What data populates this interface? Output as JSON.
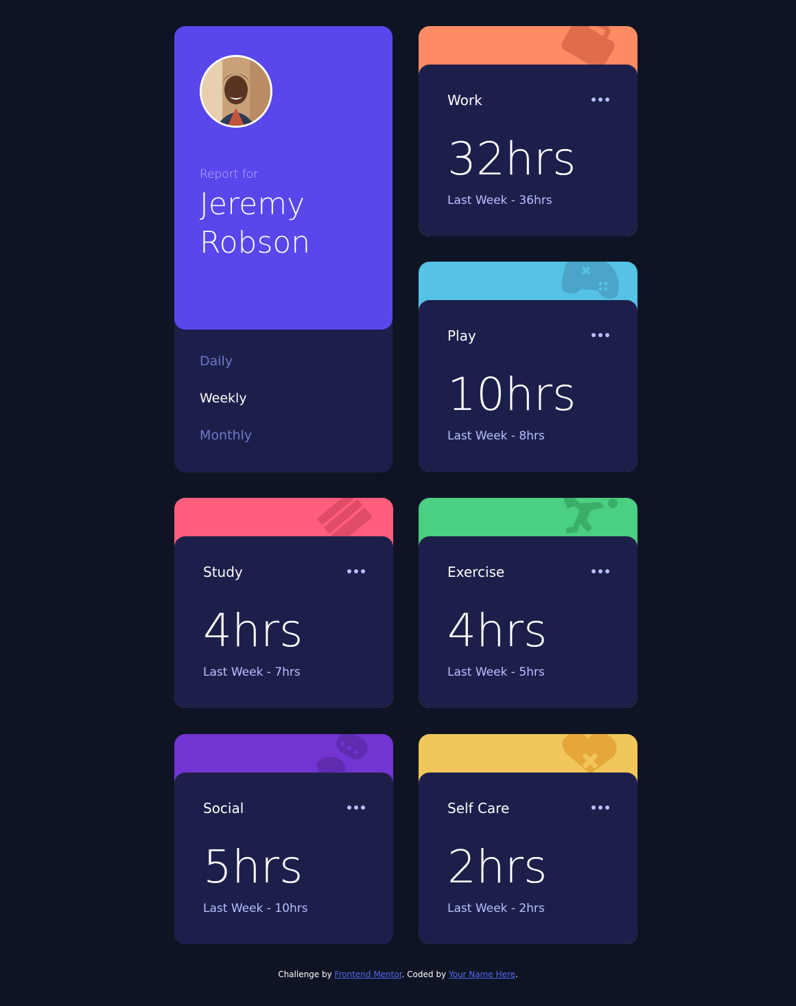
{
  "profile": {
    "report_for": "Report for",
    "first_name": "Jeremy",
    "last_name": "Robson",
    "avatar_icon": "avatar-photo"
  },
  "periods": [
    {
      "label": "Daily",
      "active": false
    },
    {
      "label": "Weekly",
      "active": true
    },
    {
      "label": "Monthly",
      "active": false
    }
  ],
  "activities": [
    {
      "title": "Work",
      "current": "32hrs",
      "previous": "Last Week  - 36hrs",
      "color": "#ff8b64",
      "icon": "briefcase-icon"
    },
    {
      "title": "Play",
      "current": "10hrs",
      "previous": "Last Week  - 8hrs",
      "color": "#55c2e6",
      "icon": "gamepad-icon"
    },
    {
      "title": "Study",
      "current": "4hrs",
      "previous": "Last Week  - 7hrs",
      "color": "#ff5e7d",
      "icon": "book-icon"
    },
    {
      "title": "Exercise",
      "current": "4hrs",
      "previous": "Last Week  - 5hrs",
      "color": "#4bcf82",
      "icon": "runner-icon"
    },
    {
      "title": "Social",
      "current": "5hrs",
      "previous": "Last Week  - 10hrs",
      "color": "#7335d2",
      "icon": "chat-bubbles-icon"
    },
    {
      "title": "Self Care",
      "current": "2hrs",
      "previous": "Last Week  - 2hrs",
      "color": "#f1c75b",
      "icon": "heart-icon"
    }
  ],
  "footer": {
    "challenge_by": "Challenge by",
    "frontend_mentor": "Frontend Mentor",
    "coded_by": ". Coded by",
    "your_name": "Your Name Here",
    "end": "."
  },
  "colors": {
    "background": "#0f1424",
    "card": "#1c1f4a",
    "profile": "#5847eb",
    "muted_text": "#bbc0ff",
    "inactive_period": "#7078c9"
  }
}
